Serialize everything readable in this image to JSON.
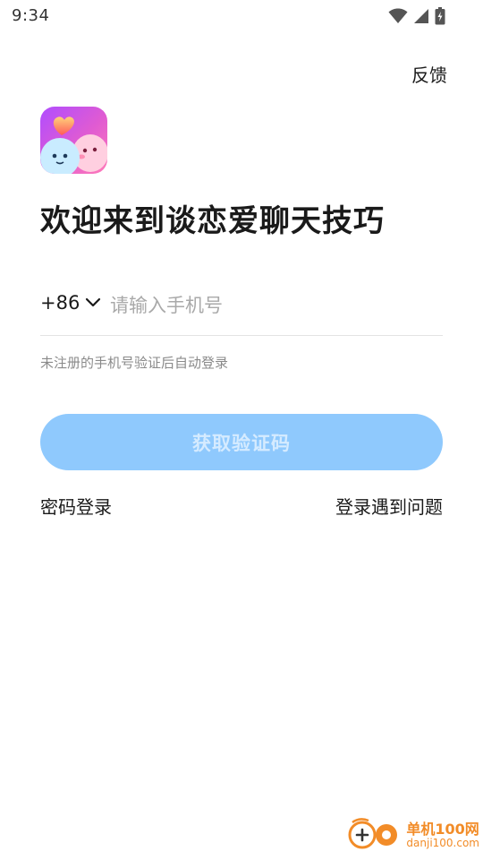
{
  "status_bar": {
    "time": "9:34",
    "icons": [
      "wifi-icon",
      "signal-icon",
      "battery-icon"
    ]
  },
  "header": {
    "feedback_label": "反馈"
  },
  "app": {
    "logo_icon": "app-logo-icon"
  },
  "welcome": {
    "title": "欢迎来到谈恋爱聊天技巧"
  },
  "phone": {
    "country_code": "+86",
    "placeholder": "请输入手机号",
    "value": ""
  },
  "hint": "未注册的手机号验证后自动登录",
  "actions": {
    "get_code_label": "获取验证码",
    "password_login_label": "密码登录",
    "login_problem_label": "登录遇到问题"
  },
  "watermark": {
    "title": "单机100网",
    "url": "danji100.com"
  },
  "colors": {
    "button_bg": "#8fc9fd",
    "button_text": "#d5ebff",
    "watermark": "#f28c28"
  }
}
